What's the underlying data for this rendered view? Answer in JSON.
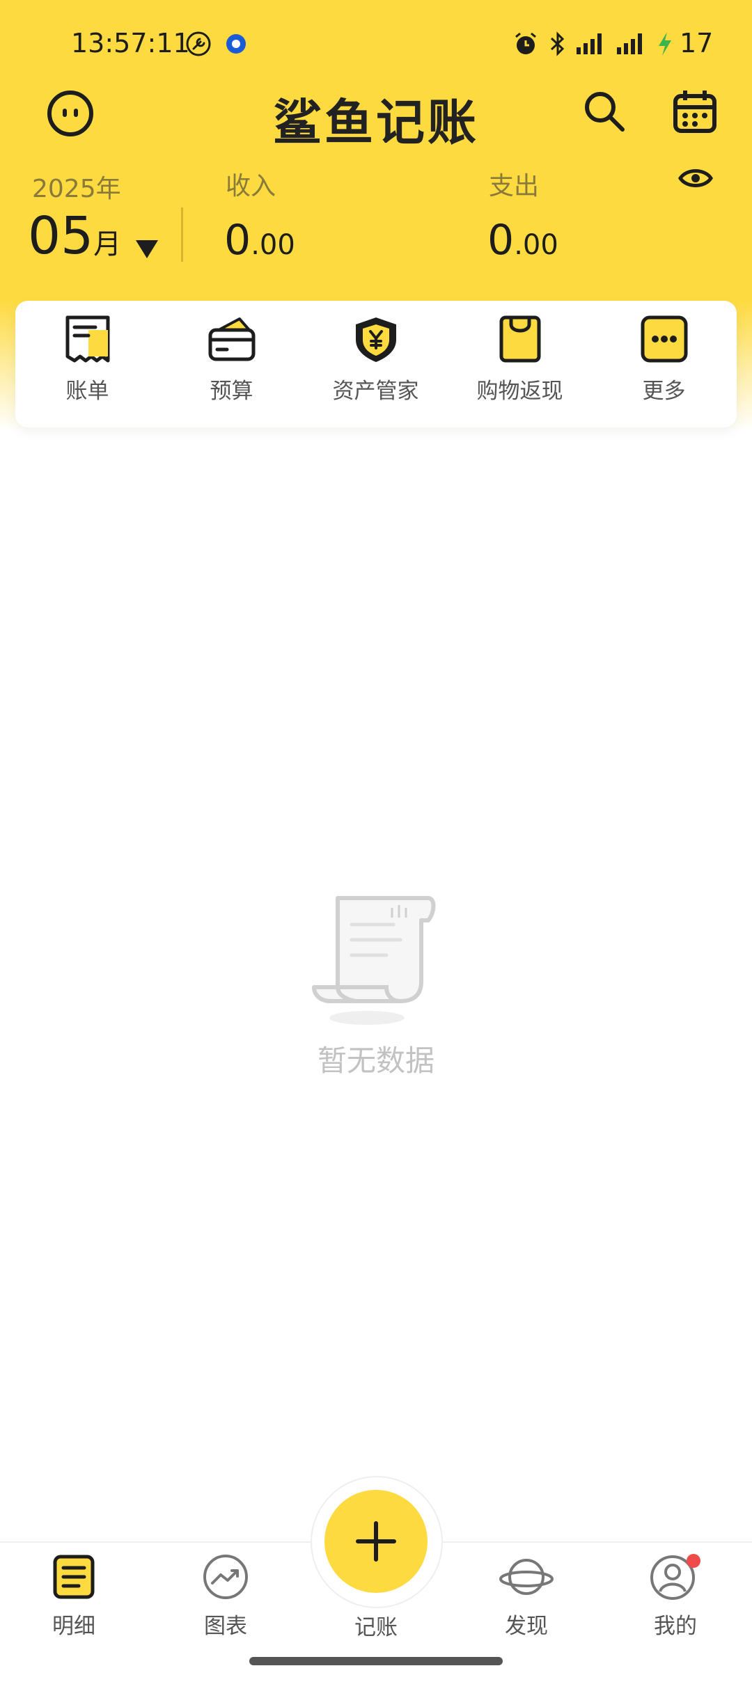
{
  "status_bar": {
    "time": "13:57:11",
    "battery": "17",
    "icons": [
      "wrench-icon",
      "location-dot-icon",
      "alarm-icon",
      "bluetooth-icon",
      "signal-icon",
      "signal-icon",
      "charging-icon"
    ]
  },
  "header": {
    "title": "鲨鱼记账",
    "left_icon": "smiley-icon",
    "right_icons": [
      "search-icon",
      "calendar-icon"
    ]
  },
  "summary": {
    "year": "2025年",
    "month_num": "05",
    "month_unit": "月",
    "income_label": "收入",
    "income_int": "0",
    "income_dec": ".00",
    "expense_label": "支出",
    "expense_int": "0",
    "expense_dec": ".00",
    "visibility_icon": "eye-icon"
  },
  "quick_actions": [
    {
      "label": "账单",
      "icon": "bill-icon"
    },
    {
      "label": "预算",
      "icon": "wallet-icon"
    },
    {
      "label": "资产管家",
      "icon": "shield-yen-icon"
    },
    {
      "label": "购物返现",
      "icon": "shopping-bag-icon"
    },
    {
      "label": "更多",
      "icon": "more-icon"
    }
  ],
  "empty_state": {
    "text": "暂无数据",
    "icon": "scroll-icon"
  },
  "bottom_nav": {
    "items": [
      {
        "label": "明细",
        "icon": "detail-list-icon",
        "active": true
      },
      {
        "label": "图表",
        "icon": "chart-icon",
        "active": false
      },
      {
        "label": "记账",
        "icon": "plus-icon",
        "active": false
      },
      {
        "label": "发现",
        "icon": "planet-icon",
        "active": false
      },
      {
        "label": "我的",
        "icon": "profile-icon",
        "active": false
      }
    ]
  },
  "colors": {
    "brand_yellow": "#FDDA3F",
    "text_dark": "#222222",
    "text_muted": "#8a7a3a",
    "badge_red": "#F04B4B",
    "empty_gray": "#c2c2c2"
  }
}
